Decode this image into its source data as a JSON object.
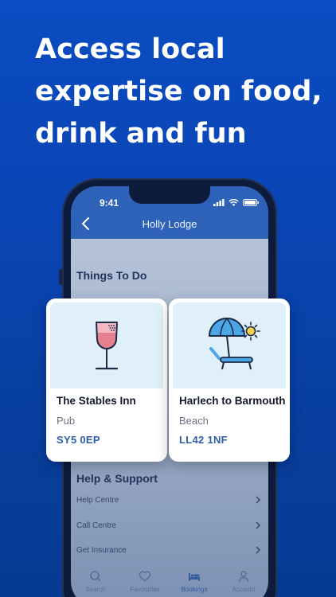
{
  "headline": "Access local\nexpertise on food,\ndrink and fun",
  "status_bar": {
    "time": "9:41"
  },
  "app": {
    "title": "Holly Lodge",
    "things_to_do_title": "Things To Do",
    "help_title": "Help & Support",
    "help_items": [
      {
        "label": "Help Centre"
      },
      {
        "label": "Call Centre"
      },
      {
        "label": "Get Insurance"
      }
    ]
  },
  "cards": [
    {
      "name": "The Stables Inn",
      "type": "Pub",
      "postcode": "SY5 0EP",
      "icon": "wine-glass-icon"
    },
    {
      "name": "Harlech to Barmouth",
      "type": "Beach",
      "postcode": "LL42 1NF",
      "icon": "beach-umbrella-icon"
    }
  ],
  "tabs": [
    {
      "label": "Search",
      "icon": "search-icon"
    },
    {
      "label": "Favourites",
      "icon": "heart-icon"
    },
    {
      "label": "Bookings",
      "icon": "bed-icon",
      "active": true
    },
    {
      "label": "Account",
      "icon": "person-icon"
    }
  ],
  "colors": {
    "background": "#0a4cc2",
    "accent": "#2d5ea8",
    "appbar": "#2e62b8"
  }
}
